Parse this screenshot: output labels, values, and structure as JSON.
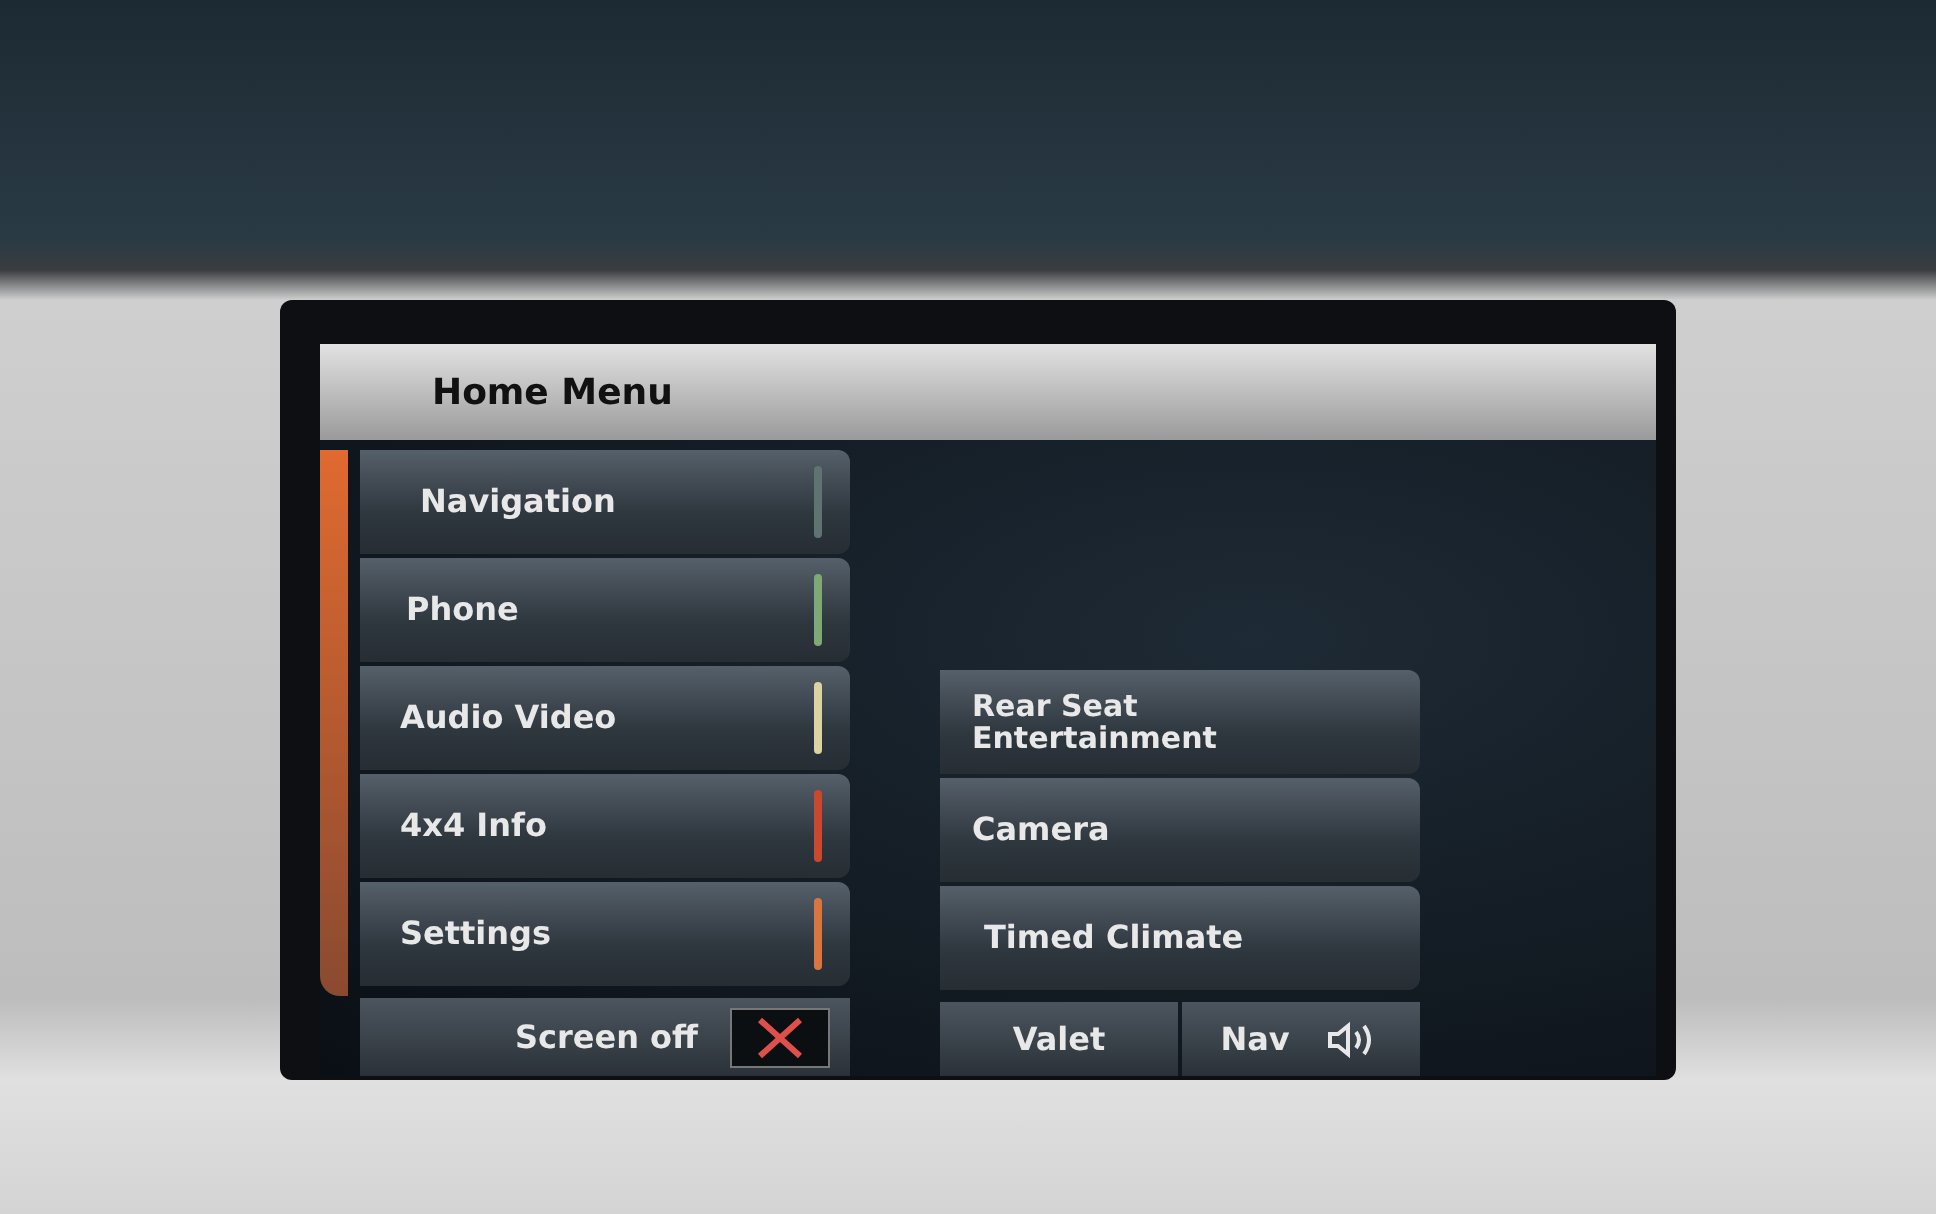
{
  "screen": {
    "title": "Home Menu",
    "main_menu": [
      {
        "label": "Navigation",
        "color": "#5f7470"
      },
      {
        "label": "Phone",
        "color": "#7fa877"
      },
      {
        "label": "Audio Video",
        "color": "#dcd3a4"
      },
      {
        "label": "4x4 Info",
        "color": "#c9482e"
      },
      {
        "label": "Settings",
        "color": "#d9763f"
      }
    ],
    "screen_off": {
      "label": "Screen off"
    },
    "side_menu": [
      "Rear Seat Entertainment",
      "Camera",
      "Timed Climate"
    ],
    "bottom_buttons": [
      {
        "label": "Valet",
        "kind": "text"
      },
      {
        "label": "Nav",
        "kind": "audio"
      }
    ]
  }
}
